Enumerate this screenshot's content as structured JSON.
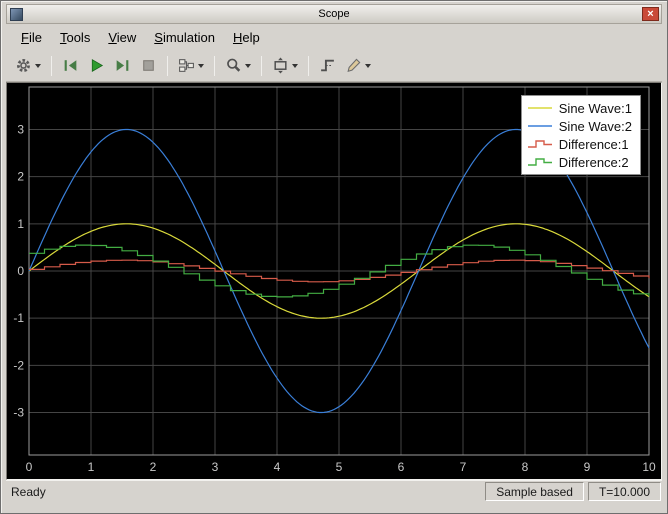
{
  "window": {
    "title": "Scope",
    "close_glyph": "×"
  },
  "menu": {
    "items": [
      {
        "label": "File",
        "mnemonic_index": 0
      },
      {
        "label": "Tools",
        "mnemonic_index": 0
      },
      {
        "label": "View",
        "mnemonic_index": 0
      },
      {
        "label": "Simulation",
        "mnemonic_index": 0
      },
      {
        "label": "Help",
        "mnemonic_index": 0
      }
    ]
  },
  "toolbar": {
    "items": [
      {
        "type": "button",
        "name": "settings",
        "icon": "gear-icon",
        "dropdown": true
      },
      {
        "type": "separator"
      },
      {
        "type": "button",
        "name": "step-back",
        "icon": "step-back-icon",
        "dropdown": false
      },
      {
        "type": "button",
        "name": "run",
        "icon": "run-icon",
        "dropdown": false
      },
      {
        "type": "button",
        "name": "step-forward",
        "icon": "step-forward-icon",
        "dropdown": false
      },
      {
        "type": "button",
        "name": "stop",
        "icon": "stop-icon",
        "dropdown": false
      },
      {
        "type": "separator"
      },
      {
        "type": "button",
        "name": "signal-selector",
        "icon": "signal-selector-icon",
        "dropdown": true
      },
      {
        "type": "separator"
      },
      {
        "type": "button",
        "name": "zoom",
        "icon": "zoom-icon",
        "dropdown": true
      },
      {
        "type": "separator"
      },
      {
        "type": "button",
        "name": "scale-axes",
        "icon": "scale-axes-icon",
        "dropdown": true
      },
      {
        "type": "separator"
      },
      {
        "type": "button",
        "name": "triggers",
        "icon": "triggers-icon",
        "dropdown": false
      },
      {
        "type": "button",
        "name": "measurements",
        "icon": "measurements-icon",
        "dropdown": true
      }
    ]
  },
  "chart_data": {
    "type": "line",
    "title": "",
    "xlabel": "",
    "ylabel": "",
    "x_range": [
      0,
      10
    ],
    "y_range": [
      -3.9,
      3.9
    ],
    "x_ticks": [
      0,
      1,
      2,
      3,
      4,
      5,
      6,
      7,
      8,
      9,
      10
    ],
    "y_ticks": [
      -3,
      -2,
      -1,
      0,
      1,
      2,
      3
    ],
    "grid": true,
    "background": "#000000",
    "grid_color": "#454545",
    "axis_color": "#9c9c9c",
    "tick_label_color": "#c8c8c8",
    "legend_position": "top-right",
    "series": [
      {
        "name": "Sine Wave:1",
        "color": "#d9d93b",
        "style": "line",
        "signal": {
          "type": "sine",
          "amplitude": 1,
          "omega": 1,
          "phase": 0,
          "offset": 0
        }
      },
      {
        "name": "Sine Wave:2",
        "color": "#3a7fd8",
        "style": "line",
        "signal": {
          "type": "sine",
          "amplitude": 3,
          "omega": 1,
          "phase": 0,
          "offset": 0
        }
      },
      {
        "name": "Difference:1",
        "color": "#d65b4a",
        "style": "stair",
        "sample_time": 0.25,
        "signal": {
          "type": "sine",
          "amplitude": 0.23,
          "omega": 1,
          "phase": 0.15,
          "offset": 0
        }
      },
      {
        "name": "Difference:2",
        "color": "#43ad43",
        "style": "stair",
        "sample_time": 0.25,
        "signal": {
          "type": "sine",
          "amplitude": 0.55,
          "omega": 1,
          "phase": 0.75,
          "offset": 0
        }
      }
    ]
  },
  "status_bar": {
    "ready": "Ready",
    "sample_mode": "Sample based",
    "time": "T=10.000"
  }
}
